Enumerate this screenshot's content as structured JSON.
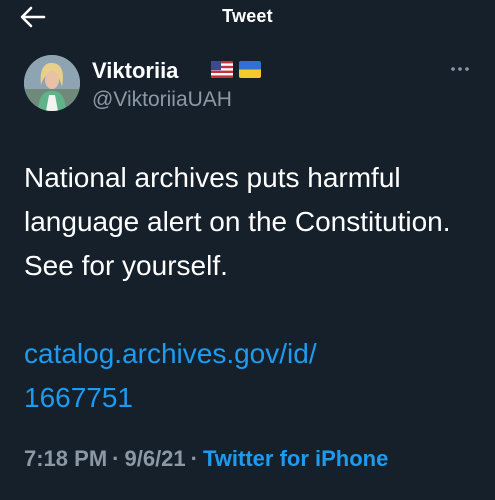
{
  "header": {
    "title": "Tweet"
  },
  "author": {
    "display_name": "Viktoriia",
    "handle": "@ViktoriiaUAH",
    "flags": [
      "us-flag-icon",
      "ukraine-flag-icon"
    ]
  },
  "tweet": {
    "text": "National archives puts harmful language alert on the Constitution. See for yourself.",
    "link_line1": "catalog.archives.gov/id/",
    "link_line2": "1667751"
  },
  "meta": {
    "time": "7:18 PM",
    "separator": "·",
    "date": "9/6/21",
    "source": "Twitter for iPhone"
  },
  "colors": {
    "background": "#15202b",
    "text": "#ffffff",
    "secondary_text": "#8b98a5",
    "link": "#1d9bf0"
  }
}
